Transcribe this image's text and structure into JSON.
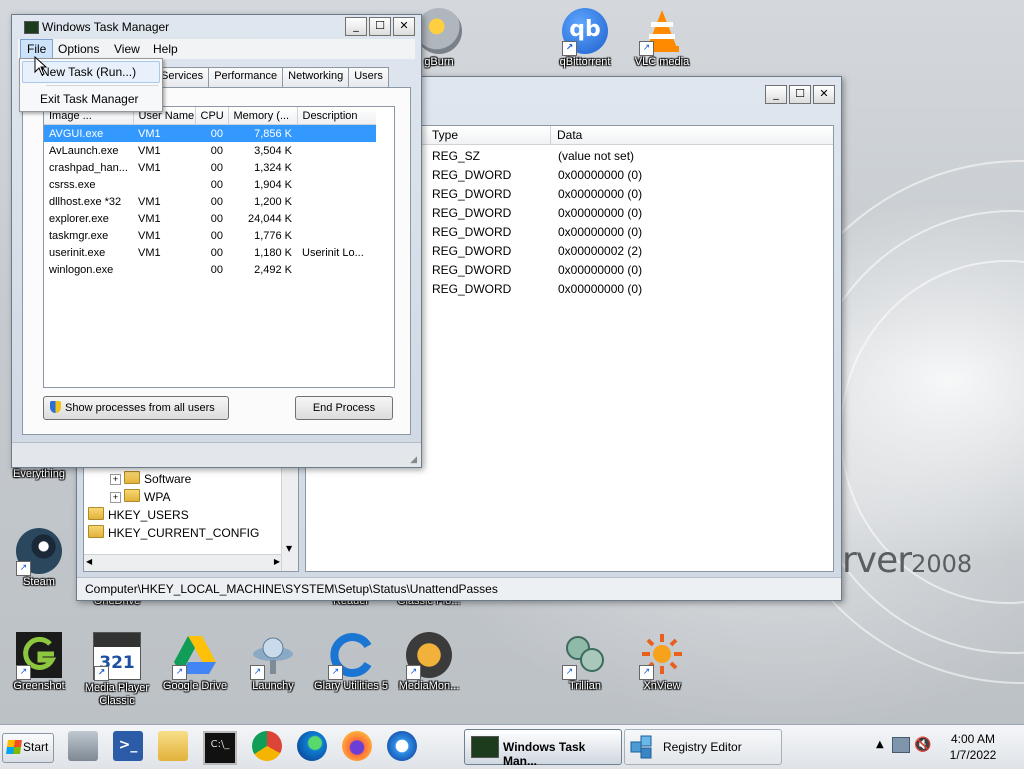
{
  "desktop": {
    "brand_text": "rver",
    "brand_version": "2008",
    "top_icons": [
      {
        "label": "gBurn",
        "icon": "imgburn-icon"
      },
      {
        "label": "qBittorrent",
        "icon": "qbittorrent-icon"
      },
      {
        "label": "VLC media",
        "icon": "vlc-icon"
      }
    ],
    "left_icons": [
      {
        "label": "Everything",
        "icon": "everything-icon"
      },
      {
        "label": "Steam",
        "icon": "steam-icon"
      }
    ],
    "partial_labels": [
      "OneDrive",
      "Reader",
      "Classic Flo..."
    ],
    "bottom_icons": [
      {
        "label": "Greenshot",
        "icon": "greenshot-icon"
      },
      {
        "label": "Media Player Classic",
        "icon": "mpc-icon"
      },
      {
        "label": "Google Drive",
        "icon": "google-drive-icon"
      },
      {
        "label": "Launchy",
        "icon": "launchy-icon"
      },
      {
        "label": "Glary Utilities 5",
        "icon": "glary-icon"
      },
      {
        "label": "MediaMon...",
        "icon": "mediamonkey-icon"
      },
      {
        "label": "Trillian",
        "icon": "trillian-icon"
      },
      {
        "label": "XnView",
        "icon": "xnview-icon"
      }
    ]
  },
  "regedit": {
    "columns": [
      "Type",
      "Data"
    ],
    "rows": [
      {
        "type": "REG_SZ",
        "data": "(value not set)"
      },
      {
        "type": "REG_DWORD",
        "data": "0x00000000 (0)"
      },
      {
        "type": "REG_DWORD",
        "data": "0x00000000 (0)"
      },
      {
        "type": "REG_DWORD",
        "data": "0x00000000 (0)"
      },
      {
        "type": "REG_DWORD",
        "data": "0x00000000 (0)"
      },
      {
        "type": "REG_DWORD",
        "data": "0x00000002 (2)"
      },
      {
        "type": "REG_DWORD",
        "data": "0x00000000 (0)"
      },
      {
        "type": "REG_DWORD",
        "data": "0x00000000 (0)"
      }
    ],
    "tree": [
      {
        "label": "Software",
        "indent": 2,
        "expander": "+"
      },
      {
        "label": "WPA",
        "indent": 2,
        "expander": "+"
      },
      {
        "label": "HKEY_USERS",
        "indent": 0,
        "expander": ""
      },
      {
        "label": "HKEY_CURRENT_CONFIG",
        "indent": 0,
        "expander": ""
      }
    ],
    "status_path": "Computer\\HKEY_LOCAL_MACHINE\\SYSTEM\\Setup\\Status\\UnattendPasses"
  },
  "taskmgr": {
    "title": "Windows Task Manager",
    "menu": [
      "File",
      "Options",
      "View",
      "Help"
    ],
    "file_menu": [
      "New Task (Run...)",
      "Exit Task Manager"
    ],
    "tabs": [
      "Services",
      "Performance",
      "Networking",
      "Users"
    ],
    "columns": [
      "Image ...",
      "User Name",
      "CPU",
      "Memory (...",
      "Description"
    ],
    "processes": [
      {
        "name": "AVGUI.exe",
        "user": "VM1",
        "cpu": "00",
        "mem": "7,856 K",
        "desc": "",
        "selected": true
      },
      {
        "name": "AvLaunch.exe",
        "user": "VM1",
        "cpu": "00",
        "mem": "3,504 K",
        "desc": ""
      },
      {
        "name": "crashpad_han...",
        "user": "VM1",
        "cpu": "00",
        "mem": "1,324 K",
        "desc": ""
      },
      {
        "name": "csrss.exe",
        "user": "",
        "cpu": "00",
        "mem": "1,904 K",
        "desc": ""
      },
      {
        "name": "dllhost.exe *32",
        "user": "VM1",
        "cpu": "00",
        "mem": "1,200 K",
        "desc": ""
      },
      {
        "name": "explorer.exe",
        "user": "VM1",
        "cpu": "00",
        "mem": "24,044 K",
        "desc": ""
      },
      {
        "name": "taskmgr.exe",
        "user": "VM1",
        "cpu": "00",
        "mem": "1,776 K",
        "desc": ""
      },
      {
        "name": "userinit.exe",
        "user": "VM1",
        "cpu": "00",
        "mem": "1,180 K",
        "desc": "Userinit Lo..."
      },
      {
        "name": "winlogon.exe",
        "user": "",
        "cpu": "00",
        "mem": "2,492 K",
        "desc": ""
      }
    ],
    "show_all_label": "Show processes from all users",
    "end_process_label": "End Process"
  },
  "taskbar": {
    "start_label": "Start",
    "pinned": [
      "server-manager-icon",
      "powershell-icon",
      "explorer-folder-icon",
      "cmd-icon",
      "chrome-icon",
      "edge-icon",
      "firefox-icon",
      "ie-icon"
    ],
    "tasks": [
      {
        "label": "Windows Task Man...",
        "active": true
      },
      {
        "label": "Registry Editor",
        "active": false
      }
    ],
    "time": "4:00 AM",
    "date": "1/7/2022"
  },
  "colors": {
    "selection": "#3399ff",
    "menu_highlight": "#cde3fb",
    "window_frame": "#cfd8e3"
  }
}
